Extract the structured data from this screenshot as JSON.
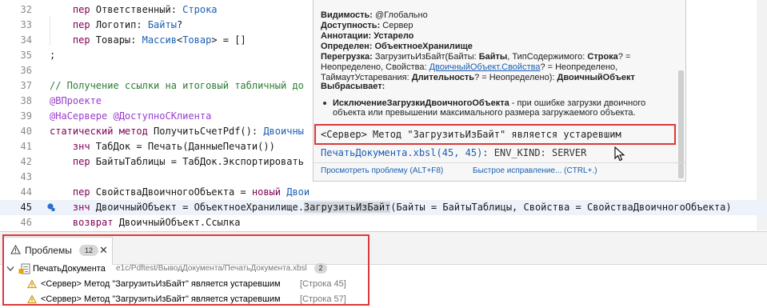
{
  "editor": {
    "lines": [
      {
        "n": "32",
        "tokens": [
          [
            "kw",
            "    пер "
          ],
          [
            "id",
            "Ответственный"
          ],
          [
            "op",
            ": "
          ],
          [
            "ty",
            "Строка"
          ]
        ]
      },
      {
        "n": "33",
        "tokens": [
          [
            "kw",
            "    пер "
          ],
          [
            "id",
            "Логотип"
          ],
          [
            "op",
            ": "
          ],
          [
            "ty",
            "Байты"
          ],
          [
            "op",
            "?"
          ]
        ]
      },
      {
        "n": "34",
        "tokens": [
          [
            "kw",
            "    пер "
          ],
          [
            "id",
            "Товары"
          ],
          [
            "op",
            ": "
          ],
          [
            "ty",
            "Массив"
          ],
          [
            "op",
            "<"
          ],
          [
            "ty",
            "Товар"
          ],
          [
            "op",
            "> = []"
          ]
        ]
      },
      {
        "n": "35",
        "tokens": [
          [
            "op",
            ";"
          ]
        ]
      },
      {
        "n": "36",
        "tokens": []
      },
      {
        "n": "37",
        "tokens": [
          [
            "cm",
            "// Получение ссылки на итоговый табличный до"
          ]
        ]
      },
      {
        "n": "38",
        "tokens": [
          [
            "an",
            "@ВПроекте"
          ]
        ]
      },
      {
        "n": "39",
        "tokens": [
          [
            "an",
            "@НаСервере @ДоступноСКлиента"
          ]
        ]
      },
      {
        "n": "40",
        "tokens": [
          [
            "kw",
            "статический метод "
          ],
          [
            "fn",
            "ПолучитьСчетPdf"
          ],
          [
            "op",
            "(): "
          ],
          [
            "ty",
            "Двоичны"
          ]
        ]
      },
      {
        "n": "41",
        "tokens": [
          [
            "kw",
            "    знч "
          ],
          [
            "id",
            "ТабДок"
          ],
          [
            "op",
            " = "
          ],
          [
            "fn",
            "Печать"
          ],
          [
            "op",
            "("
          ],
          [
            "fn",
            "ДанныеПечати"
          ],
          [
            "op",
            "())"
          ]
        ]
      },
      {
        "n": "42",
        "tokens": [
          [
            "kw",
            "    пер "
          ],
          [
            "id",
            "БайтыТаблицы"
          ],
          [
            "op",
            " = "
          ],
          [
            "id",
            "ТабДок"
          ],
          [
            "op",
            "."
          ],
          [
            "fn",
            "Экспортировать"
          ]
        ]
      },
      {
        "n": "43",
        "tokens": []
      },
      {
        "n": "44",
        "tokens": [
          [
            "kw",
            "    пер "
          ],
          [
            "id",
            "СвойстваДвоичногоОбъекта"
          ],
          [
            "op",
            " = "
          ],
          [
            "kw",
            "новый "
          ],
          [
            "ty",
            "Двои"
          ]
        ]
      },
      {
        "n": "45",
        "tokens": [
          [
            "kw",
            "    знч "
          ],
          [
            "id",
            "ДвоичныйОбъект"
          ],
          [
            "op",
            " = "
          ],
          [
            "id",
            "ОбъектноеХранилище"
          ],
          [
            "op",
            "."
          ],
          [
            "sel",
            "ЗагрузитьИзБайт"
          ],
          [
            "op",
            "("
          ],
          [
            "id",
            "Байты"
          ],
          [
            "op",
            " = "
          ],
          [
            "id",
            "БайтыТаблицы"
          ],
          [
            "op",
            ", "
          ],
          [
            "id",
            "Свойства"
          ],
          [
            "op",
            " = "
          ],
          [
            "id",
            "СвойстваДвоичногоОбъекта"
          ],
          [
            "op",
            ")"
          ]
        ]
      },
      {
        "n": "46",
        "tokens": [
          [
            "kw",
            "    возврат "
          ],
          [
            "id",
            "ДвоичныйОбъект"
          ],
          [
            "op",
            "."
          ],
          [
            "id",
            "Ссылка"
          ]
        ]
      },
      {
        "n": "47",
        "tokens": [
          [
            "op",
            ";"
          ]
        ]
      }
    ],
    "current_line": "45"
  },
  "popup": {
    "visibility_label": "Видимость:",
    "visibility_value": "@Глобально",
    "access_label": "Доступность:",
    "access_value": "Сервер",
    "annotations_label": "Аннотации:",
    "annotations_value": "Устарело",
    "defined_label": "Определен:",
    "defined_value": "ОбъектноеХранилище",
    "overload_label": "Перегрузка:",
    "overload_line1_a": "ЗагрузитьИзБайт(Байты: ",
    "overload_line1_b": "Байты",
    "overload_line1_c": ", ТипСодержимого: ",
    "overload_line1_d": "Строка",
    "overload_line1_e": "? =",
    "overload_line2_a": "Неопределено, Свойства: ",
    "overload_line2_link": "ДвоичныйОбъект.Свойства",
    "overload_line2_b": "? = Неопределено,",
    "overload_line3_a": "ТаймаутУстаревания: ",
    "overload_line3_b": "Длительность",
    "overload_line3_c": "? = Неопределено): ",
    "overload_line3_d": "ДвоичныйОбъект",
    "throws_label": "Выбрасывает:",
    "exception_name": "ИсключениеЗагрузкиДвоичногоОбъекта",
    "exception_desc1": " - при ошибке загрузки двоичного",
    "exception_desc2": "объекта или превышении максимального размера загружаемого объекта.",
    "warning_message": "<Сервер> Метод \"ЗагрузитьИзБайт\" является устаревшим",
    "location_link": "ПечатьДокумента.xbsl(45, 45)",
    "location_suffix": ": ENV_KIND: SERVER",
    "view_problem": "Просмотреть проблему (ALT+F8)",
    "quick_fix": "Быстрое исправление... (CTRL+.)"
  },
  "problems": {
    "tab_label": "Проблемы",
    "tab_count": "12",
    "file_name": "ПечатьДокумента",
    "file_path": "e1c/Pdftest/ВыводДокумента/ПечатьДокумента.xbsl",
    "file_count": "2",
    "items": [
      {
        "message": "<Сервер> Метод \"ЗагрузитьИзБайт\" является устаревшим",
        "location": "[Строка 45]"
      },
      {
        "message": "<Сервер> Метод \"ЗагрузитьИзБайт\" является устаревшим",
        "location": "[Строка 57]"
      }
    ]
  },
  "colors": {
    "keyword": "#7f0055",
    "type": "#1a5fb4",
    "comment": "#2e7d32",
    "annotation": "#9a3bd0",
    "highlight_box": "#d93a3a",
    "warning": "#e0a100"
  }
}
